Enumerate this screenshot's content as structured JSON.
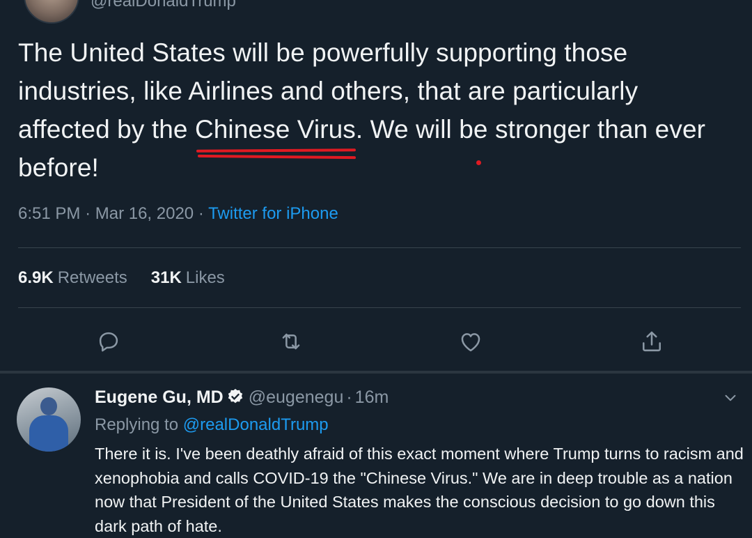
{
  "tweet": {
    "handle_partial": "@realDonaldTrump",
    "body_before": "The United States will be powerfully supporting those industries, like Airlines and others, that are particularly affected by the ",
    "body_highlight": "Chinese Virus",
    "body_after": ". We will be stronger than ever before!",
    "time": "6:51 PM",
    "date": "Mar 16, 2020",
    "source": "Twitter for iPhone",
    "retweets_count": "6.9K",
    "retweets_label": "Retweets",
    "likes_count": "31K",
    "likes_label": "Likes",
    "actions": [
      {
        "name": "reply",
        "icon": "reply-icon"
      },
      {
        "name": "retweet",
        "icon": "retweet-icon"
      },
      {
        "name": "like",
        "icon": "heart-icon"
      },
      {
        "name": "share",
        "icon": "share-icon"
      }
    ]
  },
  "reply": {
    "name": "Eugene Gu, MD",
    "verified": true,
    "handle": "@eugenegu",
    "time": "16m",
    "replying_prefix": "Replying to",
    "replying_to": "@realDonaldTrump",
    "text": "There it is. I've been deathly afraid of this exact moment where Trump turns to racism and xenophobia and calls COVID-19 the \"Chinese Virus.\" We are in deep trouble as a nation now that President of the United States makes the conscious decision to go down this dark path of hate."
  },
  "colors": {
    "background": "#15202b",
    "text": "#f1f3f4",
    "secondary": "#8b98a5",
    "accent": "#1d9bf0",
    "annotation": "#e01a22"
  }
}
